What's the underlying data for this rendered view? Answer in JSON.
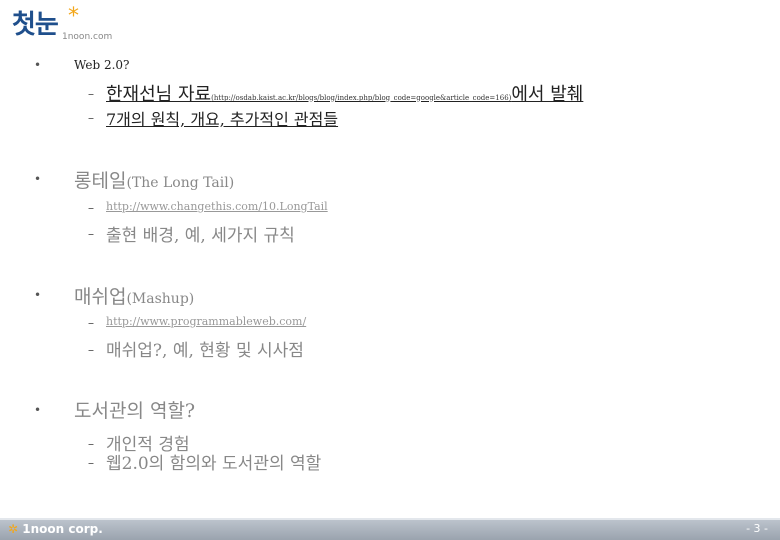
{
  "logo": {
    "text": "첫눈",
    "star": "*",
    "sub": "1noon.com"
  },
  "sections": [
    {
      "bullet": "•",
      "title": "Web 2.0?",
      "items": [
        {
          "dash": "–",
          "pre": "한재선님 자료",
          "link": "(http://osdab.kaist.ac.kr/blogs/blog/index.php/blog_code=google&article_code=166)",
          "post": "에서 발췌"
        },
        {
          "dash": "–",
          "text": "7개의 원칙, 개요, 추가적인 관점들"
        }
      ]
    },
    {
      "bullet": "•",
      "title": "롱테일",
      "title_suffix": "(The Long Tail)",
      "items": [
        {
          "dash": "–",
          "link": "http://www.changethis.com/10.LongTail"
        },
        {
          "dash": "–",
          "text": "출현 배경, 예, 세가지 규칙"
        }
      ]
    },
    {
      "bullet": "•",
      "title": "매쉬업",
      "title_suffix": "(Mashup)",
      "items": [
        {
          "dash": "–",
          "link": "http://www.programmableweb.com/"
        },
        {
          "dash": "–",
          "text": "매쉬업?, 예, 현황 및 시사점"
        }
      ]
    },
    {
      "bullet": "•",
      "title": "도서관의 역할?",
      "items": [
        {
          "dash": "–",
          "text": "개인적 경험"
        },
        {
          "dash": "–",
          "text": "웹2.0의 함의와 도서관의 역할"
        }
      ]
    }
  ],
  "footer": {
    "logo_mark": "✲",
    "logo_text": "1noon corp.",
    "page": "- 3 -"
  }
}
